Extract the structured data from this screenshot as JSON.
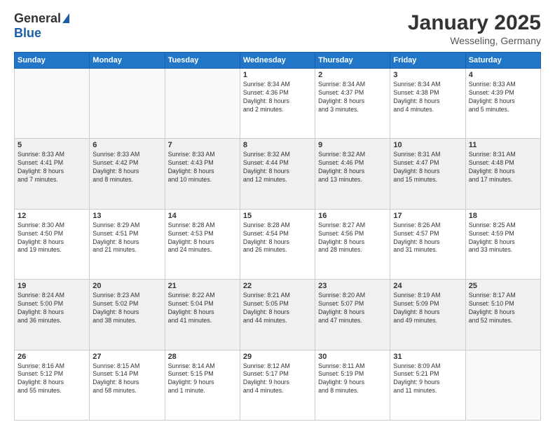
{
  "logo": {
    "general": "General",
    "blue": "Blue"
  },
  "header": {
    "month": "January 2025",
    "location": "Wesseling, Germany"
  },
  "weekdays": [
    "Sunday",
    "Monday",
    "Tuesday",
    "Wednesday",
    "Thursday",
    "Friday",
    "Saturday"
  ],
  "weeks": [
    [
      {
        "day": "",
        "info": "",
        "empty": true
      },
      {
        "day": "",
        "info": "",
        "empty": true
      },
      {
        "day": "",
        "info": "",
        "empty": true
      },
      {
        "day": "1",
        "info": "Sunrise: 8:34 AM\nSunset: 4:36 PM\nDaylight: 8 hours\nand 2 minutes."
      },
      {
        "day": "2",
        "info": "Sunrise: 8:34 AM\nSunset: 4:37 PM\nDaylight: 8 hours\nand 3 minutes."
      },
      {
        "day": "3",
        "info": "Sunrise: 8:34 AM\nSunset: 4:38 PM\nDaylight: 8 hours\nand 4 minutes."
      },
      {
        "day": "4",
        "info": "Sunrise: 8:33 AM\nSunset: 4:39 PM\nDaylight: 8 hours\nand 5 minutes."
      }
    ],
    [
      {
        "day": "5",
        "info": "Sunrise: 8:33 AM\nSunset: 4:41 PM\nDaylight: 8 hours\nand 7 minutes."
      },
      {
        "day": "6",
        "info": "Sunrise: 8:33 AM\nSunset: 4:42 PM\nDaylight: 8 hours\nand 8 minutes."
      },
      {
        "day": "7",
        "info": "Sunrise: 8:33 AM\nSunset: 4:43 PM\nDaylight: 8 hours\nand 10 minutes."
      },
      {
        "day": "8",
        "info": "Sunrise: 8:32 AM\nSunset: 4:44 PM\nDaylight: 8 hours\nand 12 minutes."
      },
      {
        "day": "9",
        "info": "Sunrise: 8:32 AM\nSunset: 4:46 PM\nDaylight: 8 hours\nand 13 minutes."
      },
      {
        "day": "10",
        "info": "Sunrise: 8:31 AM\nSunset: 4:47 PM\nDaylight: 8 hours\nand 15 minutes."
      },
      {
        "day": "11",
        "info": "Sunrise: 8:31 AM\nSunset: 4:48 PM\nDaylight: 8 hours\nand 17 minutes."
      }
    ],
    [
      {
        "day": "12",
        "info": "Sunrise: 8:30 AM\nSunset: 4:50 PM\nDaylight: 8 hours\nand 19 minutes."
      },
      {
        "day": "13",
        "info": "Sunrise: 8:29 AM\nSunset: 4:51 PM\nDaylight: 8 hours\nand 21 minutes."
      },
      {
        "day": "14",
        "info": "Sunrise: 8:28 AM\nSunset: 4:53 PM\nDaylight: 8 hours\nand 24 minutes."
      },
      {
        "day": "15",
        "info": "Sunrise: 8:28 AM\nSunset: 4:54 PM\nDaylight: 8 hours\nand 26 minutes."
      },
      {
        "day": "16",
        "info": "Sunrise: 8:27 AM\nSunset: 4:56 PM\nDaylight: 8 hours\nand 28 minutes."
      },
      {
        "day": "17",
        "info": "Sunrise: 8:26 AM\nSunset: 4:57 PM\nDaylight: 8 hours\nand 31 minutes."
      },
      {
        "day": "18",
        "info": "Sunrise: 8:25 AM\nSunset: 4:59 PM\nDaylight: 8 hours\nand 33 minutes."
      }
    ],
    [
      {
        "day": "19",
        "info": "Sunrise: 8:24 AM\nSunset: 5:00 PM\nDaylight: 8 hours\nand 36 minutes."
      },
      {
        "day": "20",
        "info": "Sunrise: 8:23 AM\nSunset: 5:02 PM\nDaylight: 8 hours\nand 38 minutes."
      },
      {
        "day": "21",
        "info": "Sunrise: 8:22 AM\nSunset: 5:04 PM\nDaylight: 8 hours\nand 41 minutes."
      },
      {
        "day": "22",
        "info": "Sunrise: 8:21 AM\nSunset: 5:05 PM\nDaylight: 8 hours\nand 44 minutes."
      },
      {
        "day": "23",
        "info": "Sunrise: 8:20 AM\nSunset: 5:07 PM\nDaylight: 8 hours\nand 47 minutes."
      },
      {
        "day": "24",
        "info": "Sunrise: 8:19 AM\nSunset: 5:09 PM\nDaylight: 8 hours\nand 49 minutes."
      },
      {
        "day": "25",
        "info": "Sunrise: 8:17 AM\nSunset: 5:10 PM\nDaylight: 8 hours\nand 52 minutes."
      }
    ],
    [
      {
        "day": "26",
        "info": "Sunrise: 8:16 AM\nSunset: 5:12 PM\nDaylight: 8 hours\nand 55 minutes."
      },
      {
        "day": "27",
        "info": "Sunrise: 8:15 AM\nSunset: 5:14 PM\nDaylight: 8 hours\nand 58 minutes."
      },
      {
        "day": "28",
        "info": "Sunrise: 8:14 AM\nSunset: 5:15 PM\nDaylight: 9 hours\nand 1 minute."
      },
      {
        "day": "29",
        "info": "Sunrise: 8:12 AM\nSunset: 5:17 PM\nDaylight: 9 hours\nand 4 minutes."
      },
      {
        "day": "30",
        "info": "Sunrise: 8:11 AM\nSunset: 5:19 PM\nDaylight: 9 hours\nand 8 minutes."
      },
      {
        "day": "31",
        "info": "Sunrise: 8:09 AM\nSunset: 5:21 PM\nDaylight: 9 hours\nand 11 minutes."
      },
      {
        "day": "",
        "info": "",
        "empty": true
      }
    ]
  ]
}
